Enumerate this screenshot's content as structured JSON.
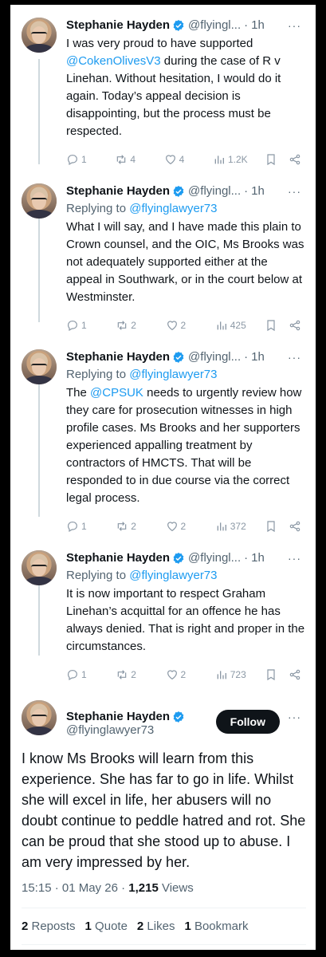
{
  "author": {
    "name": "Stephanie Hayden",
    "handle_short": "@flyingl...",
    "handle_short2": "@flyingl...",
    "handle_full": "@flyinglawyer73"
  },
  "replies": [
    {
      "time": "1h",
      "reply_to_prefix": "",
      "reply_to_handle": "",
      "text_parts": [
        "I was very proud to have supported ",
        "@CokenOlivesV3",
        " during the case of R v Linehan. Without hesitation, I would do it again. Today’s appeal decision is disappointing, but the process must be respected."
      ],
      "stats": {
        "replies": "1",
        "reposts": "4",
        "likes": "4",
        "views": "1.2K"
      }
    },
    {
      "time": "1h",
      "reply_to_prefix": "Replying to ",
      "reply_to_handle": "@flyinglawyer73",
      "text_parts": [
        "What I will say, and I have made this plain to Crown counsel, and the OIC, Ms Brooks was not adequately supported either at the appeal in Southwark, or in the court below at Westminster.",
        "",
        ""
      ],
      "stats": {
        "replies": "1",
        "reposts": "2",
        "likes": "2",
        "views": "425"
      }
    },
    {
      "time": "1h",
      "reply_to_prefix": "Replying to ",
      "reply_to_handle": "@flyinglawyer73",
      "text_parts": [
        "The ",
        "@CPSUK",
        " needs to urgently review how they care for prosecution witnesses in high profile cases. Ms Brooks and her supporters experienced appalling treatment by contractors of HMCTS. That will be responded to in due course via the correct legal process."
      ],
      "stats": {
        "replies": "1",
        "reposts": "2",
        "likes": "2",
        "views": "372"
      }
    },
    {
      "time": "1h",
      "reply_to_prefix": "Replying to ",
      "reply_to_handle": "@flyinglawyer73",
      "text_parts": [
        "It is now important to respect Graham Linehan’s acquittal for an offence he has always denied. That is right and proper in the circumstances.",
        "",
        ""
      ],
      "stats": {
        "replies": "1",
        "reposts": "2",
        "likes": "2",
        "views": "723"
      }
    }
  ],
  "main_tweet": {
    "follow_label": "Follow",
    "text": "I know Ms Brooks will learn from this experience. She has far to go in life. Whilst she will excel in life, her abusers will no doubt continue to peddle hatred and rot. She can be proud that she stood up to abuse. I am very impressed by her.",
    "time": "15:15 · 01 May 26 · ",
    "views_count": "1,215",
    "views_label": " Views",
    "reposts_count": "2",
    "reposts_label": " Reposts",
    "quotes_count": "1",
    "quotes_label": " Quote",
    "likes_count": "2",
    "likes_label": " Likes",
    "bookmarks_count": "1",
    "bookmarks_label": " Bookmark"
  },
  "ui": {
    "dot": "·",
    "more": "···"
  },
  "colors": {
    "link": "#1d9bf0",
    "verified": "#1d9bf0",
    "text": "#0f1419",
    "muted": "#536471"
  }
}
